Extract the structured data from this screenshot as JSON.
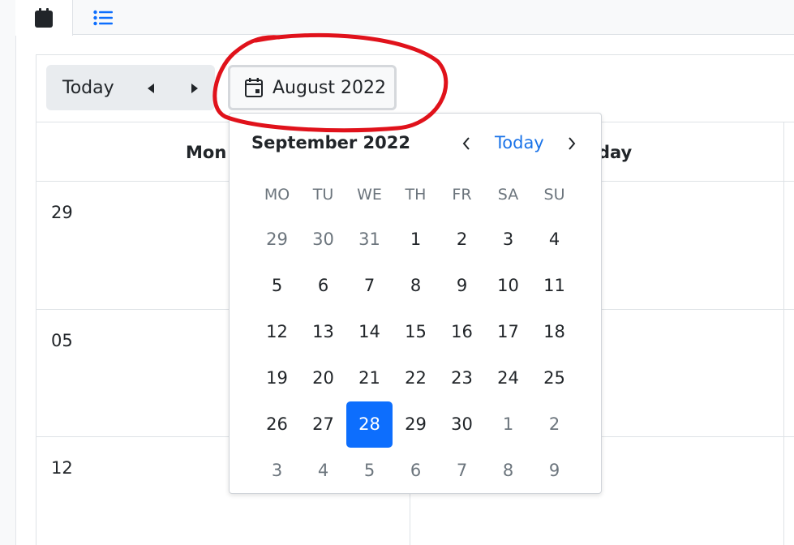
{
  "tabs": [
    {
      "name": "calendar-icon",
      "active": true
    },
    {
      "name": "list-icon",
      "active": false
    }
  ],
  "toolbar": {
    "today_label": "Today",
    "prev_icon": "caret-left-icon",
    "next_icon": "caret-right-icon",
    "month_label": "August 2022",
    "month_icon": "calendar-event-icon"
  },
  "calendar": {
    "columns": [
      "Mon",
      "day"
    ],
    "rows": [
      "29",
      "05",
      "12"
    ]
  },
  "datepicker": {
    "title": "September 2022",
    "today_label": "Today",
    "weekdays": [
      "MO",
      "TU",
      "WE",
      "TH",
      "FR",
      "SA",
      "SU"
    ],
    "weeks": [
      [
        "29",
        "30",
        "31",
        "1",
        "2",
        "3",
        "4"
      ],
      [
        "5",
        "6",
        "7",
        "8",
        "9",
        "10",
        "11"
      ],
      [
        "12",
        "13",
        "14",
        "15",
        "16",
        "17",
        "18"
      ],
      [
        "19",
        "20",
        "21",
        "22",
        "23",
        "24",
        "25"
      ],
      [
        "26",
        "27",
        "28",
        "29",
        "30",
        "1",
        "2"
      ],
      [
        "3",
        "4",
        "5",
        "6",
        "7",
        "8",
        "9"
      ]
    ],
    "muted": [
      [
        true,
        true,
        true,
        false,
        false,
        false,
        false
      ],
      [
        false,
        false,
        false,
        false,
        false,
        false,
        false
      ],
      [
        false,
        false,
        false,
        false,
        false,
        false,
        false
      ],
      [
        false,
        false,
        false,
        false,
        false,
        false,
        false
      ],
      [
        false,
        false,
        false,
        false,
        false,
        true,
        true
      ],
      [
        true,
        true,
        true,
        true,
        true,
        true,
        true
      ]
    ],
    "selected": "28"
  },
  "colors": {
    "accent": "#0d6efd",
    "annotation": "#e0121b",
    "link": "#1a73e8"
  }
}
